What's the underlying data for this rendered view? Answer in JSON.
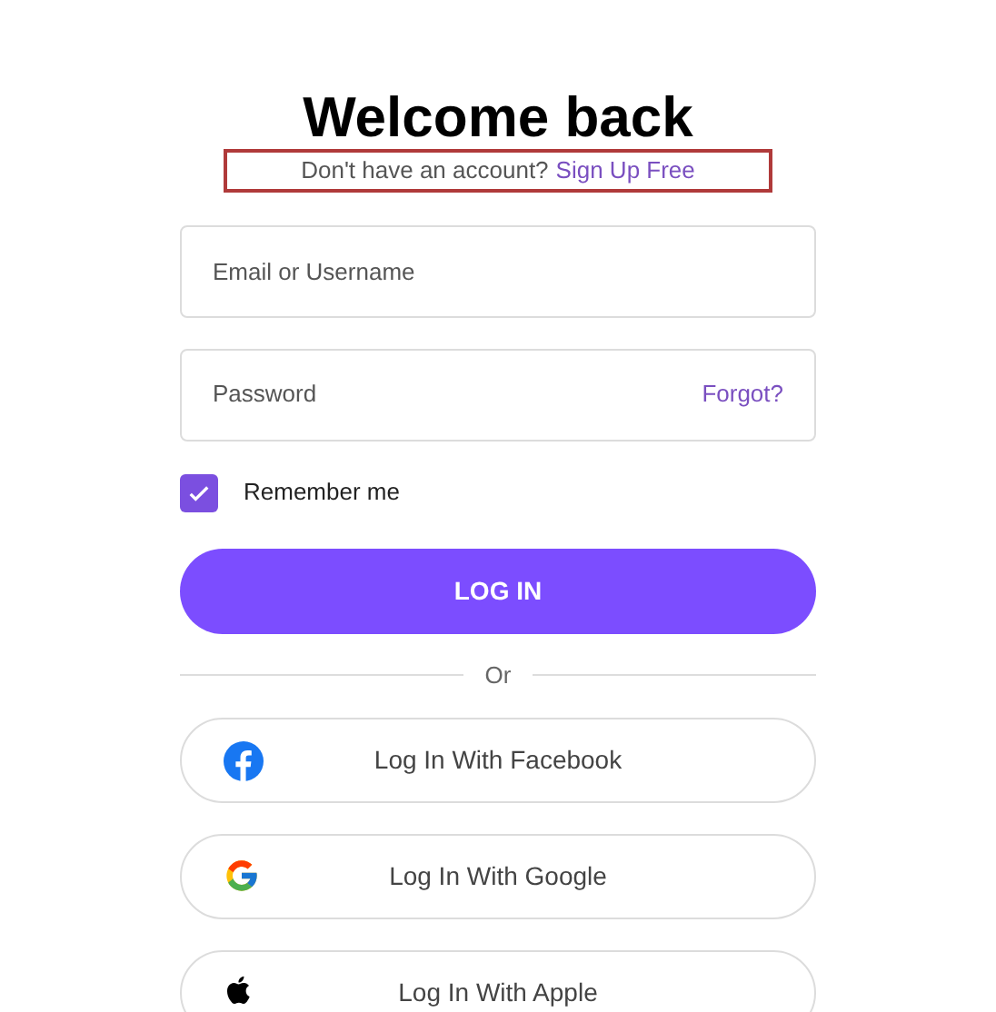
{
  "title": "Welcome back",
  "signup": {
    "prompt": "Don't have an account?",
    "link": "Sign Up Free",
    "highlighted": true
  },
  "email": {
    "placeholder": "Email or Username"
  },
  "password": {
    "placeholder": "Password",
    "forgot": "Forgot?"
  },
  "remember": {
    "label": "Remember me",
    "checked": true
  },
  "login_button": "LOG IN",
  "divider": "Or",
  "social_buttons": [
    {
      "kind": "facebook",
      "label": "Log In With Facebook"
    },
    {
      "kind": "google",
      "label": "Log In With Google"
    },
    {
      "kind": "apple",
      "label": "Log In With Apple"
    }
  ]
}
